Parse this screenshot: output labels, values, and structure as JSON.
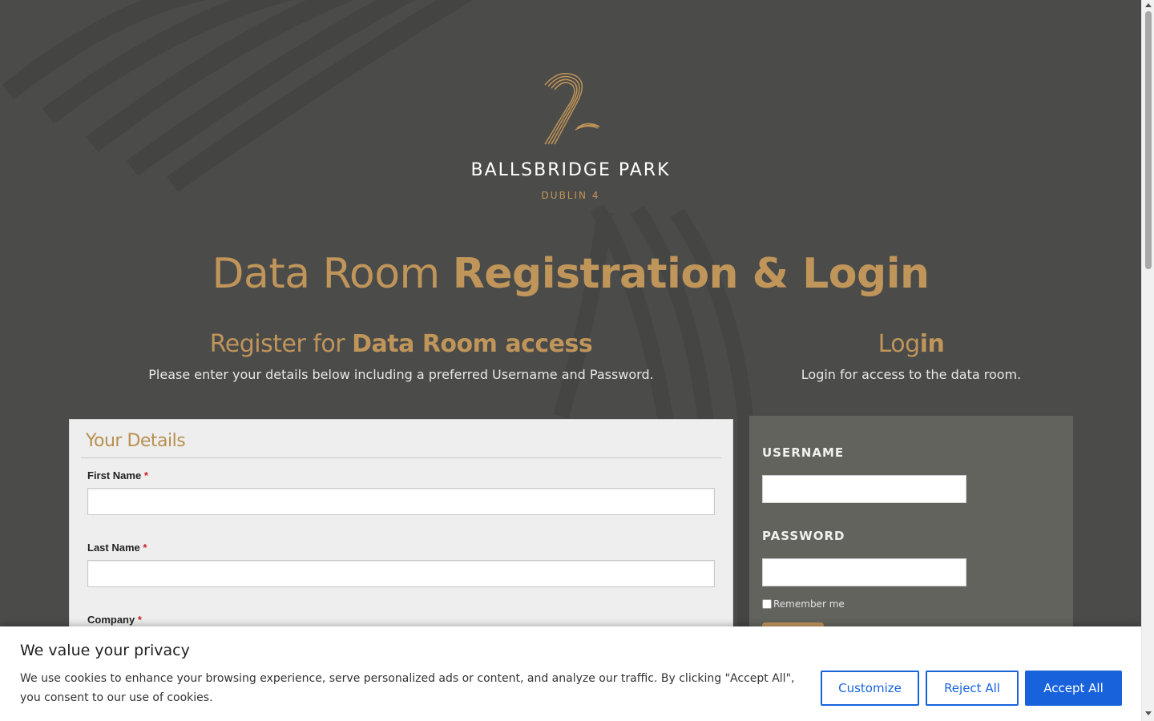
{
  "brand": {
    "name": "BALLSBRIDGE PARK",
    "location": "DUBLIN 4",
    "accent_color": "#c0955a"
  },
  "page": {
    "title_light": "Data Room",
    "title_bold": "Registration & Login"
  },
  "register": {
    "title_light": "Register for",
    "title_bold": "Data Room access",
    "subtitle": "Please enter your details below including a preferred Username and Password.",
    "panel_title": "Your Details",
    "fields": [
      {
        "label": "First Name",
        "required": "*"
      },
      {
        "label": "Last Name",
        "required": "*"
      },
      {
        "label": "Company",
        "required": "*"
      }
    ]
  },
  "login": {
    "title_light": "Log",
    "title_bold": "in",
    "subtitle": "Login for access to the data room.",
    "username_label": "USERNAME",
    "password_label": "PASSWORD",
    "remember_label": "Remember me"
  },
  "cookie_banner": {
    "title": "We value your privacy",
    "text": "We use cookies to enhance your browsing experience, serve personalized ads or content, and analyze our traffic. By clicking \"Accept All\", you consent to our use of cookies.",
    "customize_label": "Customize",
    "reject_label": "Reject All",
    "accept_label": "Accept All",
    "button_color": "#1863dc"
  }
}
